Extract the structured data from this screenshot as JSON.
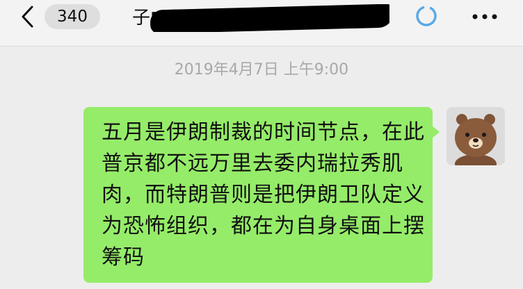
{
  "navbar": {
    "back_count": "340",
    "title": "子■■■■■■■■■们(333)"
  },
  "message": {
    "timestamp": "2019年4月7日 上午9:00",
    "text": "五月是伊朗制裁的时间节点，在此普京都不远万里去委内瑞拉秀肌肉，而特朗普则是把伊朗卫队定义为恐怖组织，都在为自身桌面上摆筹码"
  },
  "colors": {
    "bubble": "#95ec69",
    "background": "#ededed",
    "timestamp": "#a8a8a8",
    "spinner": "#5aa9e6"
  },
  "icons": {
    "back": "chevron-left-icon",
    "loading": "loading-spinner-icon",
    "more": "more-dots-icon",
    "avatar": "brown-bear-avatar"
  }
}
